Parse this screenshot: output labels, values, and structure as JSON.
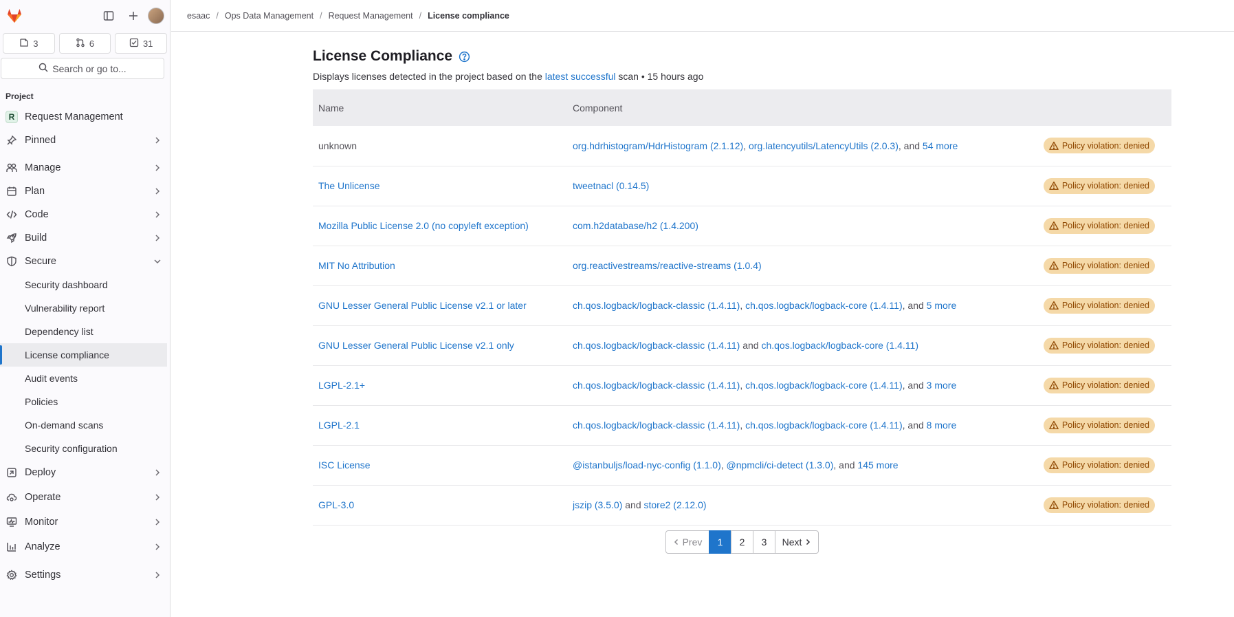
{
  "sidebar": {
    "counts": {
      "issues": "3",
      "merge_requests": "6",
      "todos": "31"
    },
    "search_label": "Search or go to...",
    "section_label": "Project",
    "project": {
      "badge": "R",
      "name": "Request Management"
    },
    "nav": [
      {
        "label": "Pinned"
      },
      {
        "label": "Manage"
      },
      {
        "label": "Plan"
      },
      {
        "label": "Code"
      },
      {
        "label": "Build"
      },
      {
        "label": "Secure"
      }
    ],
    "secure_items": [
      {
        "label": "Security dashboard"
      },
      {
        "label": "Vulnerability report"
      },
      {
        "label": "Dependency list"
      },
      {
        "label": "License compliance"
      },
      {
        "label": "Audit events"
      },
      {
        "label": "Policies"
      },
      {
        "label": "On-demand scans"
      },
      {
        "label": "Security configuration"
      }
    ],
    "nav_bottom": [
      {
        "label": "Deploy"
      },
      {
        "label": "Operate"
      },
      {
        "label": "Monitor"
      },
      {
        "label": "Analyze"
      },
      {
        "label": "Settings"
      }
    ]
  },
  "breadcrumb": [
    "esaac",
    "Ops Data Management",
    "Request Management",
    "License compliance"
  ],
  "page": {
    "title": "License Compliance",
    "subtitle_before": "Displays licenses detected in the project based on the ",
    "subtitle_link": "latest successful",
    "subtitle_after": " scan • 15 hours ago"
  },
  "table": {
    "headers": [
      "Name",
      "Component"
    ],
    "rows": [
      {
        "name": "unknown",
        "components": [
          "org.hdrhistogram/HdrHistogram (2.1.12)",
          "org.latencyutils/LatencyUtils (2.0.3)"
        ],
        "joiner": ", ",
        "tail_pre": ", and ",
        "more": "54 more",
        "status": "Policy violation: denied"
      },
      {
        "name": "The Unlicense",
        "components": [
          "tweetnacl (0.14.5)"
        ],
        "joiner": "",
        "tail_pre": "",
        "more": "",
        "status": "Policy violation: denied"
      },
      {
        "name": "Mozilla Public License 2.0 (no copyleft exception)",
        "components": [
          "com.h2database/h2 (1.4.200)"
        ],
        "joiner": "",
        "tail_pre": "",
        "more": "",
        "status": "Policy violation: denied"
      },
      {
        "name": "MIT No Attribution",
        "components": [
          "org.reactivestreams/reactive-streams (1.0.4)"
        ],
        "joiner": "",
        "tail_pre": "",
        "more": "",
        "status": "Policy violation: denied"
      },
      {
        "name": "GNU Lesser General Public License v2.1 or later",
        "components": [
          "ch.qos.logback/logback-classic (1.4.11)",
          "ch.qos.logback/logback-core (1.4.11)"
        ],
        "joiner": ", ",
        "tail_pre": ", and ",
        "more": "5 more",
        "status": "Policy violation: denied"
      },
      {
        "name": "GNU Lesser General Public License v2.1 only",
        "components": [
          "ch.qos.logback/logback-classic (1.4.11)",
          "ch.qos.logback/logback-core (1.4.11)"
        ],
        "joiner": " and ",
        "tail_pre": "",
        "more": "",
        "status": "Policy violation: denied"
      },
      {
        "name": "LGPL-2.1+",
        "components": [
          "ch.qos.logback/logback-classic (1.4.11)",
          "ch.qos.logback/logback-core (1.4.11)"
        ],
        "joiner": ", ",
        "tail_pre": ", and ",
        "more": "3 more",
        "status": "Policy violation: denied"
      },
      {
        "name": "LGPL-2.1",
        "components": [
          "ch.qos.logback/logback-classic (1.4.11)",
          "ch.qos.logback/logback-core (1.4.11)"
        ],
        "joiner": ", ",
        "tail_pre": ", and ",
        "more": "8 more",
        "status": "Policy violation: denied"
      },
      {
        "name": "ISC License",
        "components": [
          "@istanbuljs/load-nyc-config (1.1.0)",
          "@npmcli/ci-detect (1.3.0)"
        ],
        "joiner": ", ",
        "tail_pre": ", and ",
        "more": "145 more",
        "status": "Policy violation: denied"
      },
      {
        "name": "GPL-3.0",
        "components": [
          "jszip (3.5.0)",
          "store2 (2.12.0)"
        ],
        "joiner": " and ",
        "tail_pre": "",
        "more": "",
        "status": "Policy violation: denied"
      }
    ]
  },
  "pagination": {
    "prev": "Prev",
    "pages": [
      "1",
      "2",
      "3"
    ],
    "current": "1",
    "next": "Next"
  },
  "colors": {
    "link": "#1f75cb",
    "badge_bg": "#f5d9a8",
    "badge_text": "#8f4700",
    "accent": "#1f75cb"
  }
}
